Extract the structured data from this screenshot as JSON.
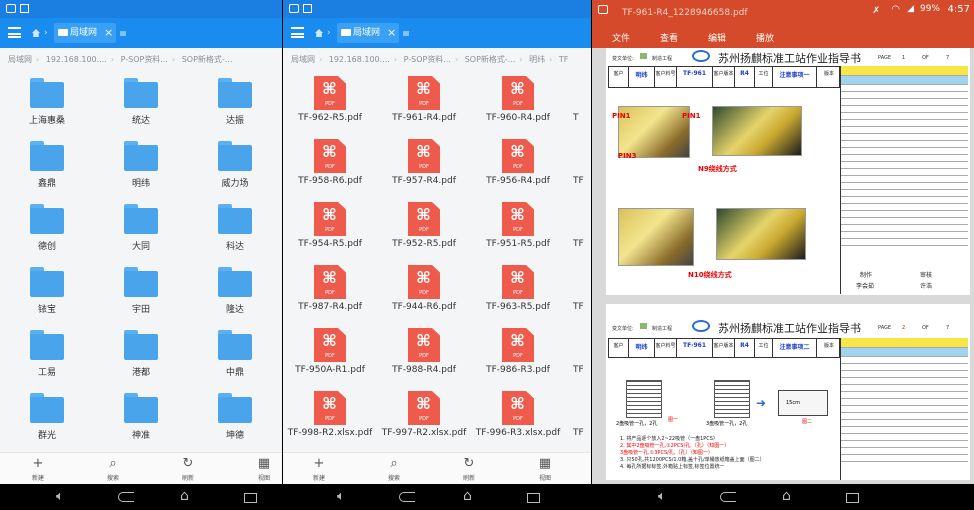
{
  "panel1": {
    "tab_label": "局域网",
    "crumbs": [
      "局域网",
      "192.168.100....",
      "P-SOP资料...",
      "SOP新格式-..."
    ],
    "folders": [
      "上海惠桑",
      "统达",
      "达振",
      "鑫鼎",
      "明纬",
      "威力场",
      "德创",
      "大同",
      "科达",
      "铱宝",
      "宇田",
      "隆达",
      "工易",
      "港都",
      "中鼎",
      "群光",
      "神准",
      "坤德"
    ],
    "bottom": [
      "新建",
      "搜索",
      "刷新",
      "视图"
    ]
  },
  "panel2": {
    "tab_label": "局域网",
    "crumbs": [
      "局域网",
      "192.168.100....",
      "P-SOP资料...",
      "SOP新格式-...",
      "明纬",
      "TF"
    ],
    "files": [
      "TF-962-R5.pdf",
      "TF-961-R4.pdf",
      "TF-960-R4.pdf",
      "TF-958-R6.pdf",
      "TF-957-R4.pdf",
      "TF-956-R4.pdf",
      "TF-954-R5.pdf",
      "TF-952-R5.pdf",
      "TF-951-R5.pdf",
      "TF-987-R4.pdf",
      "TF-944-R6.pdf",
      "TF-963-R5.pdf",
      "TF-950A-R1.pdf",
      "TF-988-R4.pdf",
      "TF-986-R3.pdf",
      "TF-998-R2.xlsx.pdf",
      "TF-997-R2.xlsx.pdf",
      "TF-996-R3.xlsx.pdf"
    ],
    "partial": [
      "T",
      "TF",
      "TF",
      "TF",
      "TF",
      "TF"
    ],
    "pdf_tag": "PDF",
    "bottom": [
      "新建",
      "搜索",
      "刷新",
      "视图"
    ]
  },
  "panel3": {
    "title": "TF-961-R4_1228946658.pdf",
    "battery": "99%",
    "time": "4:57",
    "menu": [
      "文件",
      "查看",
      "编辑",
      "播放"
    ],
    "doc": {
      "title": "苏州扬麒标准工站作业指导书",
      "changes_label": "变文单位:",
      "made_label": "制造工程",
      "page_label": "PAGE",
      "of_label": "OF",
      "total": "7",
      "page1": {
        "num": "1",
        "headers": [
          "客户",
          "明纬",
          "客户料号",
          "TF-961",
          "客户版本",
          "R4",
          "工位",
          "注意事项一",
          "版本"
        ],
        "labels": [
          "PIN1",
          "PIN3",
          "PIN1",
          "N9绕线方式",
          "N10绕线方式"
        ],
        "sign_labels": [
          "制作",
          "审核",
          "李会茹",
          "许浩"
        ]
      },
      "page2": {
        "num": "2",
        "headers": [
          "客户",
          "明纬",
          "客户料号",
          "TF-961",
          "客户版本",
          "R4",
          "工位",
          "注意事项二",
          "版本"
        ],
        "notes": [
          "1. 将产品逐个放入2~22吸管（一盘1PCS）",
          "2. 其中2盘吸管一孔,①2PCS/孔,（孔）（知图一）",
          "3盘吸管一孔,①3PCS/孔,（孔）（知图一）",
          "3. 只50孔,共1200PCS/1.0箱,盖十孔/单桶放纸箱盖上面（图二）",
          "4. 每孔所据标标签,外箱贴上标签,标签位置统一"
        ],
        "fig_labels": [
          "图一",
          "图二",
          "2盘吸管一孔，2孔",
          "3盘吸管一孔，2孔",
          "15cm"
        ]
      }
    }
  }
}
